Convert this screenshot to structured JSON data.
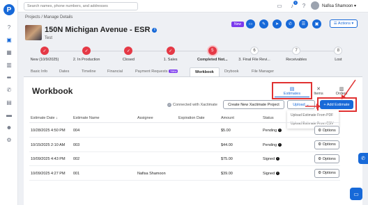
{
  "app": {
    "logo_letter": "P",
    "accent": "#1769d8",
    "step_color": "#e53946",
    "highlight": "#e03131"
  },
  "topbar": {
    "search_placeholder": "Search names, phone numbers, and addresses",
    "notification_count": "1",
    "user_name": "Nafisa Shamoon ▾"
  },
  "breadcrumb": "Projects / Manage Details",
  "project": {
    "title": "150N Michigan Avenue - ESR",
    "subtitle": "Test",
    "new_label": "New",
    "actions_label": "☰ Actions ▾"
  },
  "stepper": [
    {
      "label": "New (10/9/2025)",
      "state": "done",
      "symbol": "✓"
    },
    {
      "label": "2. In Production",
      "state": "done",
      "symbol": "✓"
    },
    {
      "label": "Closed",
      "state": "done",
      "symbol": "✓"
    },
    {
      "label": "1. Sales",
      "state": "done",
      "symbol": "✓"
    },
    {
      "label": "Completed Not...",
      "state": "current",
      "symbol": "5"
    },
    {
      "label": "3. Final File Revi...",
      "state": "todo",
      "symbol": "6"
    },
    {
      "label": "Receivables",
      "state": "todo",
      "symbol": "7"
    },
    {
      "label": "Lost",
      "state": "todo",
      "symbol": "8"
    }
  ],
  "tabs": {
    "basic_info": "Basic Info",
    "dates": "Dates",
    "timeline": "Timeline",
    "financial": "Financial",
    "payment_requests": "Payment Requests",
    "new_badge": "New",
    "workbook": "Workbook",
    "drybook": "Drybook",
    "file_manager": "File Manager"
  },
  "workbook": {
    "title": "Workbook",
    "subtabs": {
      "estimates": "Estimates",
      "items": "Items",
      "orders": "Orders"
    },
    "connected_text": "Connected with Xactimate",
    "create_btn": "Create New Xactimate Project",
    "upload_btn": "Upload ⌄",
    "add_btn": "+ Add Estimate",
    "upload_menu": [
      "Upload Estimate From PDF",
      "Upload Estimate From CSV"
    ],
    "columns": {
      "date": "Estimate Date",
      "name": "Estimate Name",
      "assignee": "Assignee",
      "expiration": "Expiration Date",
      "amount": "Amount",
      "status": "Status"
    },
    "options_label": "⚙ Options",
    "rows": [
      {
        "date": "10/28/2025 4:50 PM",
        "name": "004",
        "assignee": "",
        "expiration": "",
        "amount": "$5.00",
        "status": "Pending"
      },
      {
        "date": "10/15/2025 2:10 AM",
        "name": "003",
        "assignee": "",
        "expiration": "",
        "amount": "$44.00",
        "status": "Pending"
      },
      {
        "date": "10/09/2025 4:43 PM",
        "name": "002",
        "assignee": "",
        "expiration": "",
        "amount": "$75.00",
        "status": "Signed"
      },
      {
        "date": "10/09/2025 4:27 PM",
        "name": "001",
        "assignee": "Nafisa Shamoon",
        "expiration": "",
        "amount": "$39.00",
        "status": "Signed"
      }
    ]
  }
}
